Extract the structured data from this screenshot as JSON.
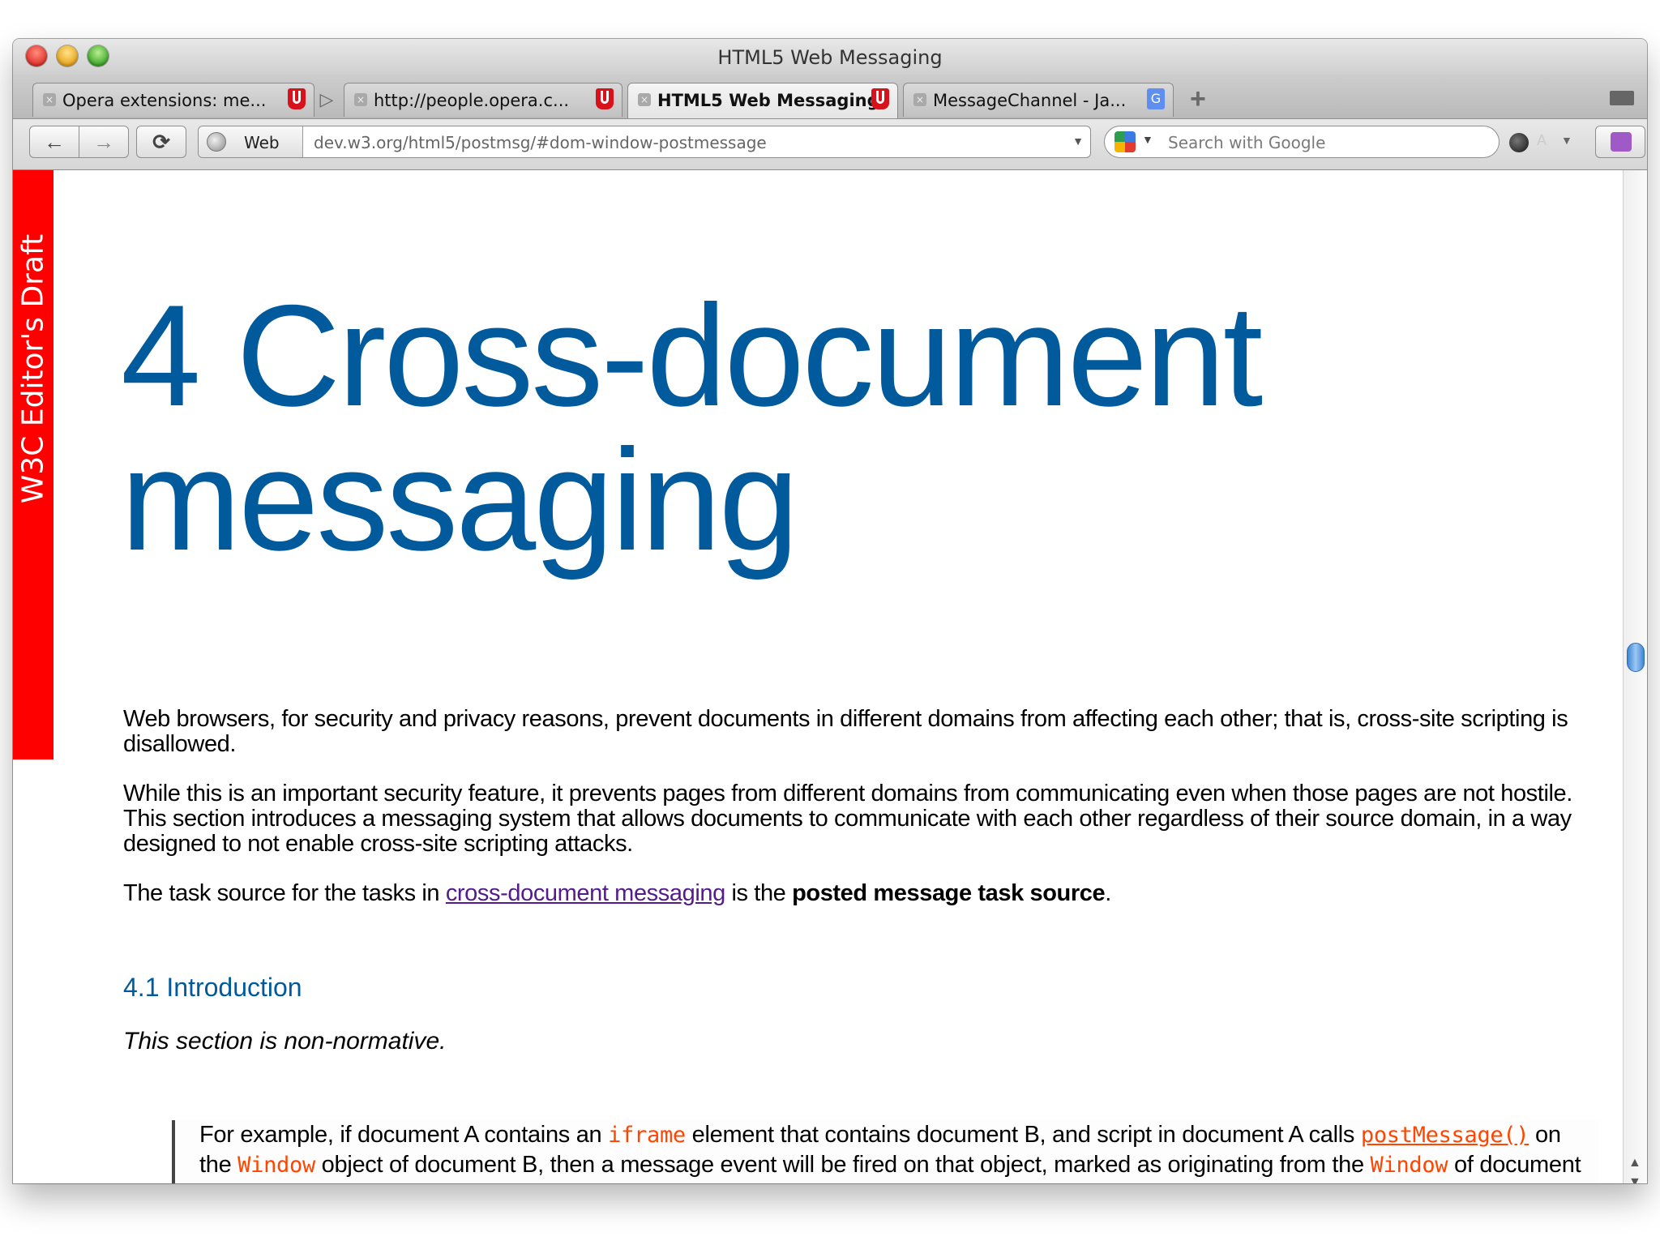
{
  "window": {
    "title": "HTML5 Web Messaging"
  },
  "tabs": [
    {
      "label": "Opera extensions: me...",
      "favicon": "opera-icon"
    },
    {
      "label": "http://people.opera.c...",
      "favicon": "opera-icon"
    },
    {
      "label": "HTML5 Web Messaging",
      "favicon": "opera-icon",
      "active": true
    },
    {
      "label": "MessageChannel - Ja...",
      "favicon": "g-icon"
    }
  ],
  "toolbar": {
    "back_icon": "←",
    "forward_icon": "→",
    "reload_icon": "⟳",
    "address_badge": "Web",
    "url": "dev.w3.org/html5/postmsg/#dom-window-postmessage",
    "search_placeholder": "Search with Google",
    "font_glyph": "A"
  },
  "page": {
    "draft_banner": "W3C Editor's Draft",
    "heading_line1": "4 Cross-document",
    "heading_line2": "messaging",
    "p1": "Web browsers, for security and privacy reasons, prevent documents in different domains from affecting each other; that is, cross-site scripting is disallowed.",
    "p2": "While this is an important security feature, it prevents pages from different domains from communicating even when those pages are not hostile. This section introduces a messaging system that allows documents to communicate with each other regardless of their source domain, in a way designed to not enable cross-site scripting attacks.",
    "p3_before": "The task source for the tasks in ",
    "p3_link": "cross-document messaging",
    "p3_middle": " is the ",
    "p3_bold": "posted message task source",
    "p3_after": ".",
    "subheading": "4.1 Introduction",
    "nonnormative": "This section is non-normative.",
    "example": {
      "t1": "For example, if document A contains an ",
      "c1": "iframe",
      "t2": " element that contains document B, and script in document A calls ",
      "c2": "postMessage()",
      "t3": " on the ",
      "c3": "Window",
      "t4": " object of document B, then a message event will be fired on that object, marked as originating from the ",
      "c4": "Window",
      "t5": " of document A. The script in document A might look like:"
    }
  },
  "colors": {
    "heading": "#005a9c",
    "banner": "#ff0000",
    "code": "#ff4500",
    "visited_link": "#551a8b"
  }
}
